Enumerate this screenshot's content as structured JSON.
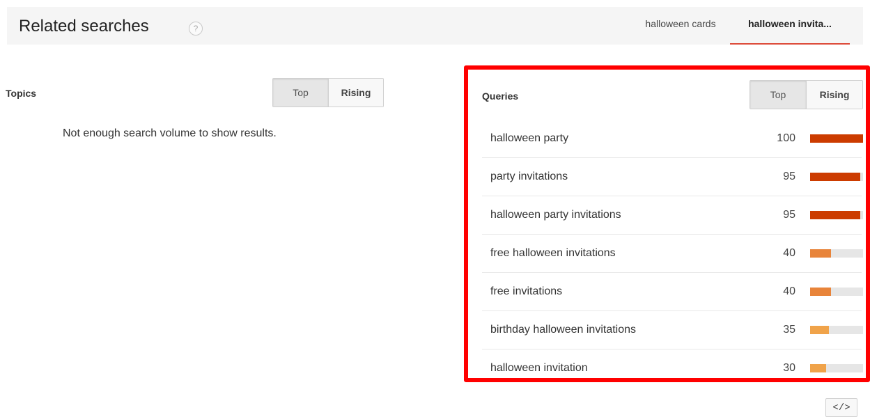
{
  "header": {
    "title": "Related searches",
    "help_icon": "question-circle-icon",
    "help_glyph": "?",
    "term_tabs": [
      {
        "label": "halloween cards",
        "active": false
      },
      {
        "label": "halloween invita...",
        "active": true
      }
    ]
  },
  "topics": {
    "title": "Topics",
    "toggle": {
      "top_label": "Top",
      "rising_label": "Rising",
      "selected": "Top"
    },
    "empty_message": "Not enough search volume to show results."
  },
  "queries": {
    "title": "Queries",
    "toggle": {
      "top_label": "Top",
      "rising_label": "Rising",
      "selected": "Top"
    },
    "rows": [
      {
        "label": "halloween party",
        "value": "100",
        "level": 1.0,
        "color": "#cc3c00"
      },
      {
        "label": "party invitations",
        "value": "95",
        "level": 0.95,
        "color": "#cc3c00"
      },
      {
        "label": "halloween party invitations",
        "value": "95",
        "level": 0.95,
        "color": "#cc3c00"
      },
      {
        "label": "free halloween invitations",
        "value": "40",
        "level": 0.4,
        "color": "#e8843a"
      },
      {
        "label": "free invitations",
        "value": "40",
        "level": 0.4,
        "color": "#e8843a"
      },
      {
        "label": "birthday halloween invitations",
        "value": "35",
        "level": 0.35,
        "color": "#f0a34a"
      },
      {
        "label": "halloween invitation",
        "value": "30",
        "level": 0.3,
        "color": "#f0a34a"
      }
    ],
    "highlight_color": "#ff0000"
  },
  "embed": {
    "label": "</>",
    "icon": "embed-code-icon"
  }
}
